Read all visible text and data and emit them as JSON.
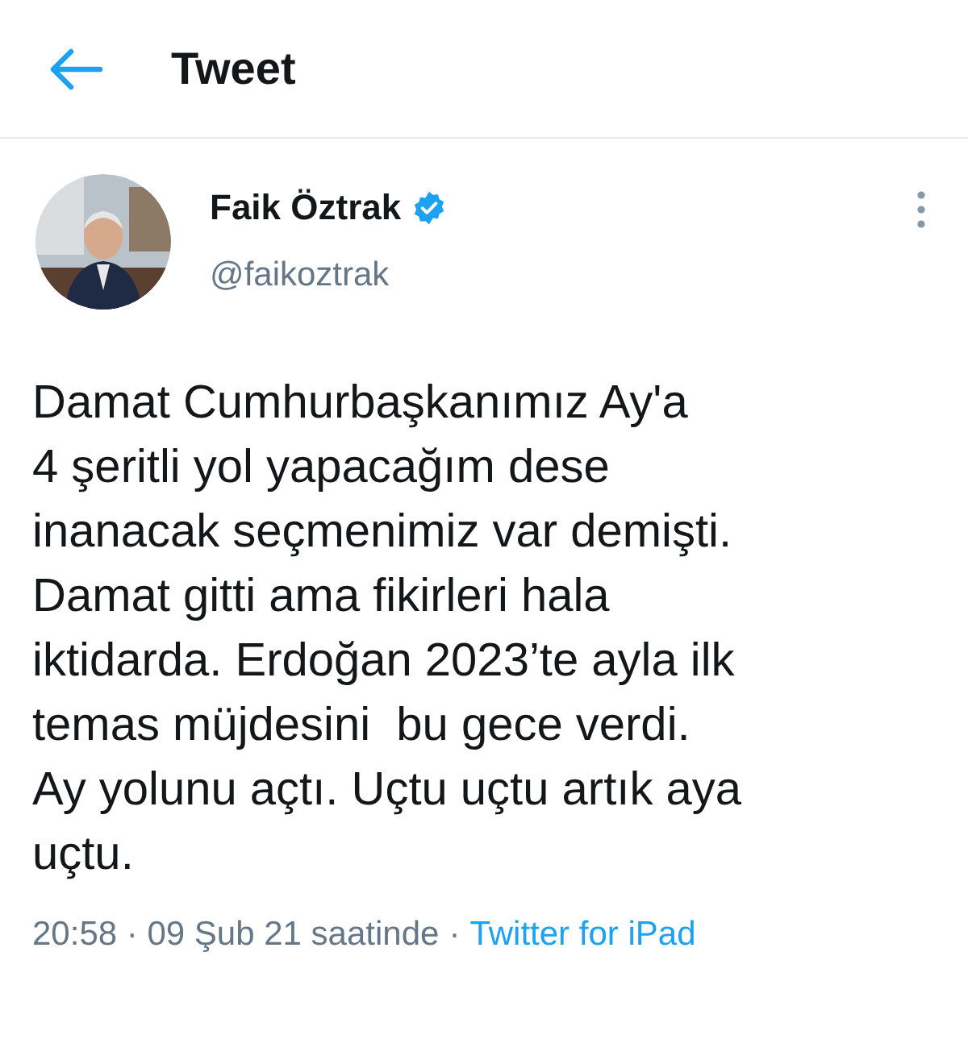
{
  "header": {
    "title": "Tweet"
  },
  "author": {
    "name": "Faik Öztrak",
    "verified": true,
    "handle": "@faikoztrak"
  },
  "tweet": {
    "text": "Damat Cumhurbaşkanımız Ay'a\n4 şeritli yol yapacağım dese\ninanacak seçmenimiz var demişti.\nDamat gitti ama fikirleri hala\niktidarda. Erdoğan 2023’te ayla ilk\ntemas müjdesini  bu gece verdi.\nAy yolunu açtı. Uçtu uçtu artık aya\nuçtu."
  },
  "meta": {
    "timestamp": "20:58 · 09 Şub 21 saatinde",
    "separator": "·",
    "source": "Twitter for iPad"
  }
}
